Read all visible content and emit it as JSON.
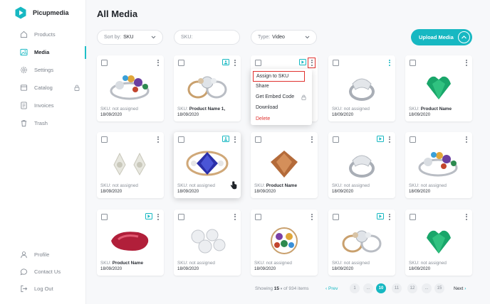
{
  "app": {
    "name": "Picupmedia",
    "brand_color": "#17b8c2"
  },
  "sidebar": {
    "items": [
      {
        "label": "Products",
        "icon": "home-icon"
      },
      {
        "label": "Media",
        "icon": "image-icon",
        "active": true
      },
      {
        "label": "Settings",
        "icon": "gear-icon"
      },
      {
        "label": "Catalog",
        "icon": "catalog-icon",
        "locked": true
      },
      {
        "label": "Invoices",
        "icon": "invoice-icon"
      },
      {
        "label": "Trash",
        "icon": "trash-icon"
      }
    ],
    "bottom": [
      {
        "label": "Profile",
        "icon": "user-icon"
      },
      {
        "label": "Contact Us",
        "icon": "chat-icon"
      },
      {
        "label": "Log Out",
        "icon": "logout-icon"
      }
    ]
  },
  "page": {
    "title": "All Media"
  },
  "filters": {
    "sort_label": "Sort by:",
    "sort_value": "SKU",
    "sku_placeholder": "SKU:",
    "type_label": "Type:",
    "type_value": "Video"
  },
  "upload_button": {
    "label": "Upload Media"
  },
  "media": [
    {
      "sku_label": "SKU:",
      "sku": "not assigned",
      "assigned": false,
      "date": "18/09/2020",
      "badge": "",
      "gem": "multi"
    },
    {
      "sku_label": "SKU:",
      "sku": "Product Name 1,",
      "assigned": true,
      "date": "18/09/2020",
      "badge": "image",
      "gem": "rings"
    },
    {
      "sku_label": "",
      "sku": "",
      "assigned": false,
      "date": "",
      "badge": "video",
      "gem": "none",
      "menu_open": true
    },
    {
      "sku_label": "SKU:",
      "sku": "not assigned",
      "assigned": false,
      "date": "18/09/2020",
      "badge": "",
      "gem": "silver",
      "teal_kebab": true
    },
    {
      "sku_label": "SKU:",
      "sku": "Product Name",
      "assigned": true,
      "date": "18/09/2020",
      "badge": "",
      "gem": "emerald"
    },
    {
      "sku_label": "SKU:",
      "sku": "not assigned",
      "assigned": false,
      "date": "18/09/2020",
      "badge": "",
      "gem": "earrings"
    },
    {
      "sku_label": "SKU:",
      "sku": "not assigned",
      "assigned": false,
      "date": "18/09/2020",
      "badge": "image",
      "gem": "sapphire",
      "hover": true
    },
    {
      "sku_label": "SKU:",
      "sku": "Product Name",
      "assigned": true,
      "date": "18/09/2020",
      "badge": "",
      "gem": "topaz"
    },
    {
      "sku_label": "SKU:",
      "sku": "not assigned",
      "assigned": false,
      "date": "18/09/2020",
      "badge": "video",
      "gem": "silver"
    },
    {
      "sku_label": "SKU:",
      "sku": "not assigned",
      "assigned": false,
      "date": "18/09/2020",
      "badge": "",
      "gem": "multi"
    },
    {
      "sku_label": "SKU:",
      "sku": "Product Name",
      "assigned": true,
      "date": "18/09/2020",
      "badge": "video",
      "gem": "ruby"
    },
    {
      "sku_label": "SKU:",
      "sku": "not assigned",
      "assigned": false,
      "date": "18/09/2020",
      "badge": "",
      "gem": "diamondflower"
    },
    {
      "sku_label": "SKU:",
      "sku": "not assigned",
      "assigned": false,
      "date": "18/09/2020",
      "badge": "",
      "gem": "cluster"
    },
    {
      "sku_label": "SKU:",
      "sku": "not assigned",
      "assigned": false,
      "date": "18/09/2020",
      "badge": "video",
      "gem": "rings"
    },
    {
      "sku_label": "SKU:",
      "sku": "not assigned",
      "assigned": false,
      "date": "18/09/2020",
      "badge": "",
      "gem": "emerald"
    }
  ],
  "context_menu": {
    "items": [
      "Assign to SKU",
      "Share",
      "Get Embed Code",
      "Download",
      "Delete"
    ]
  },
  "pagination": {
    "showing_label": "Showing",
    "per_page": "15",
    "of_text": "of 934 items",
    "prev": "Prev",
    "next": "Next",
    "pages": [
      "1",
      "...",
      "10",
      "11",
      "12",
      "...",
      "15"
    ],
    "current": "10"
  }
}
